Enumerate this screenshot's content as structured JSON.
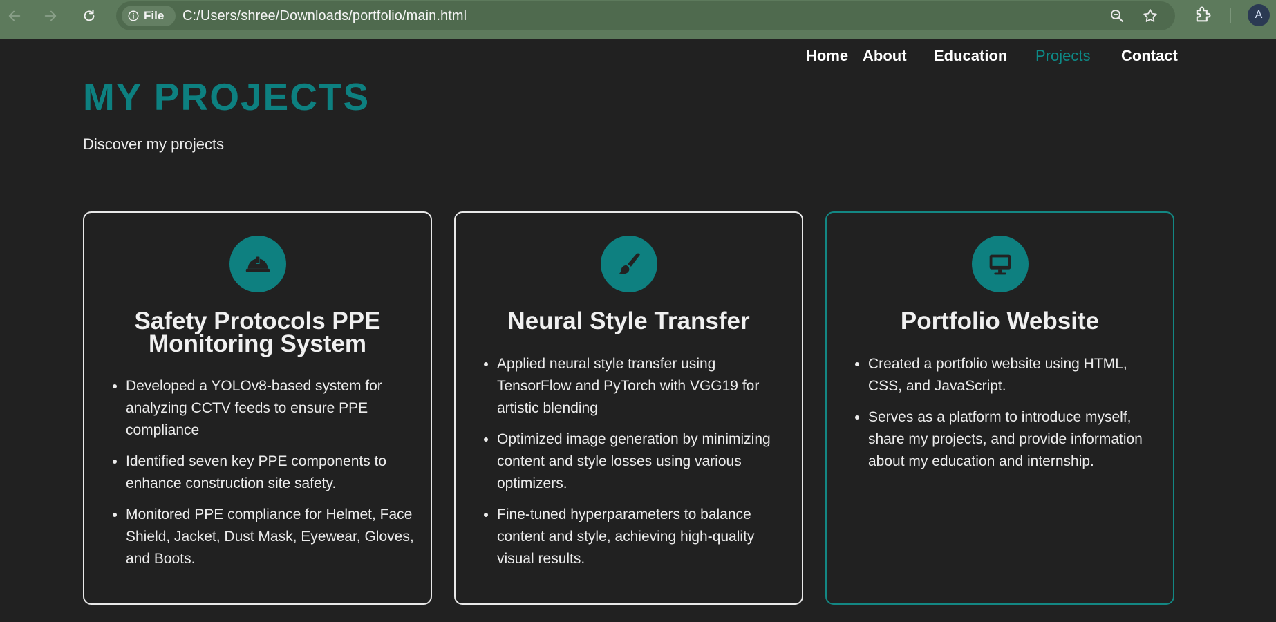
{
  "browser": {
    "site_chip": "File",
    "url": "C:/Users/shree/Downloads/portfolio/main.html",
    "avatar": "A",
    "icons": [
      "back-arrow-icon",
      "forward-arrow-icon",
      "reload-icon",
      "info-icon",
      "zoom-icon",
      "star-icon",
      "extensions-icon"
    ]
  },
  "nav": {
    "home": "Home",
    "about": "About",
    "education": "Education",
    "projects": "Projects",
    "contact": "Contact",
    "active": "Projects",
    "active_color": "#0d8a87"
  },
  "header": {
    "title": "MY PROJECTS",
    "subtitle": "Discover my projects",
    "title_color": "#0d8080"
  },
  "projects": [
    {
      "icon": "hard-hat-icon",
      "title": "Safety Protocols PPE Monitoring System",
      "bullets": [
        "Developed a YOLOv8-based system for analyzing CCTV feeds to ensure PPE compliance",
        "Identified seven key PPE components to enhance construction site safety.",
        "Monitored PPE compliance for Helmet, Face Shield, Jacket, Dust Mask, Eyewear, Gloves, and Boots."
      ]
    },
    {
      "icon": "paintbrush-icon",
      "title": "Neural Style Transfer",
      "bullets": [
        "Applied neural style transfer using TensorFlow and PyTorch with VGG19 for artistic blending",
        "Optimized image generation by minimizing content and style losses using various optimizers.",
        "Fine-tuned hyperparameters to balance content and style, achieving high-quality visual results."
      ]
    },
    {
      "icon": "desktop-monitor-icon",
      "title": "Portfolio Website",
      "bullets": [
        "Created a portfolio website using HTML, CSS, and JavaScript.",
        "Serves as a platform to introduce myself, share my projects, and provide information about my education and internship."
      ]
    }
  ],
  "colors": {
    "background": "#212121",
    "accent": "#0e8080",
    "browser_bar": "#5d7a5c"
  }
}
